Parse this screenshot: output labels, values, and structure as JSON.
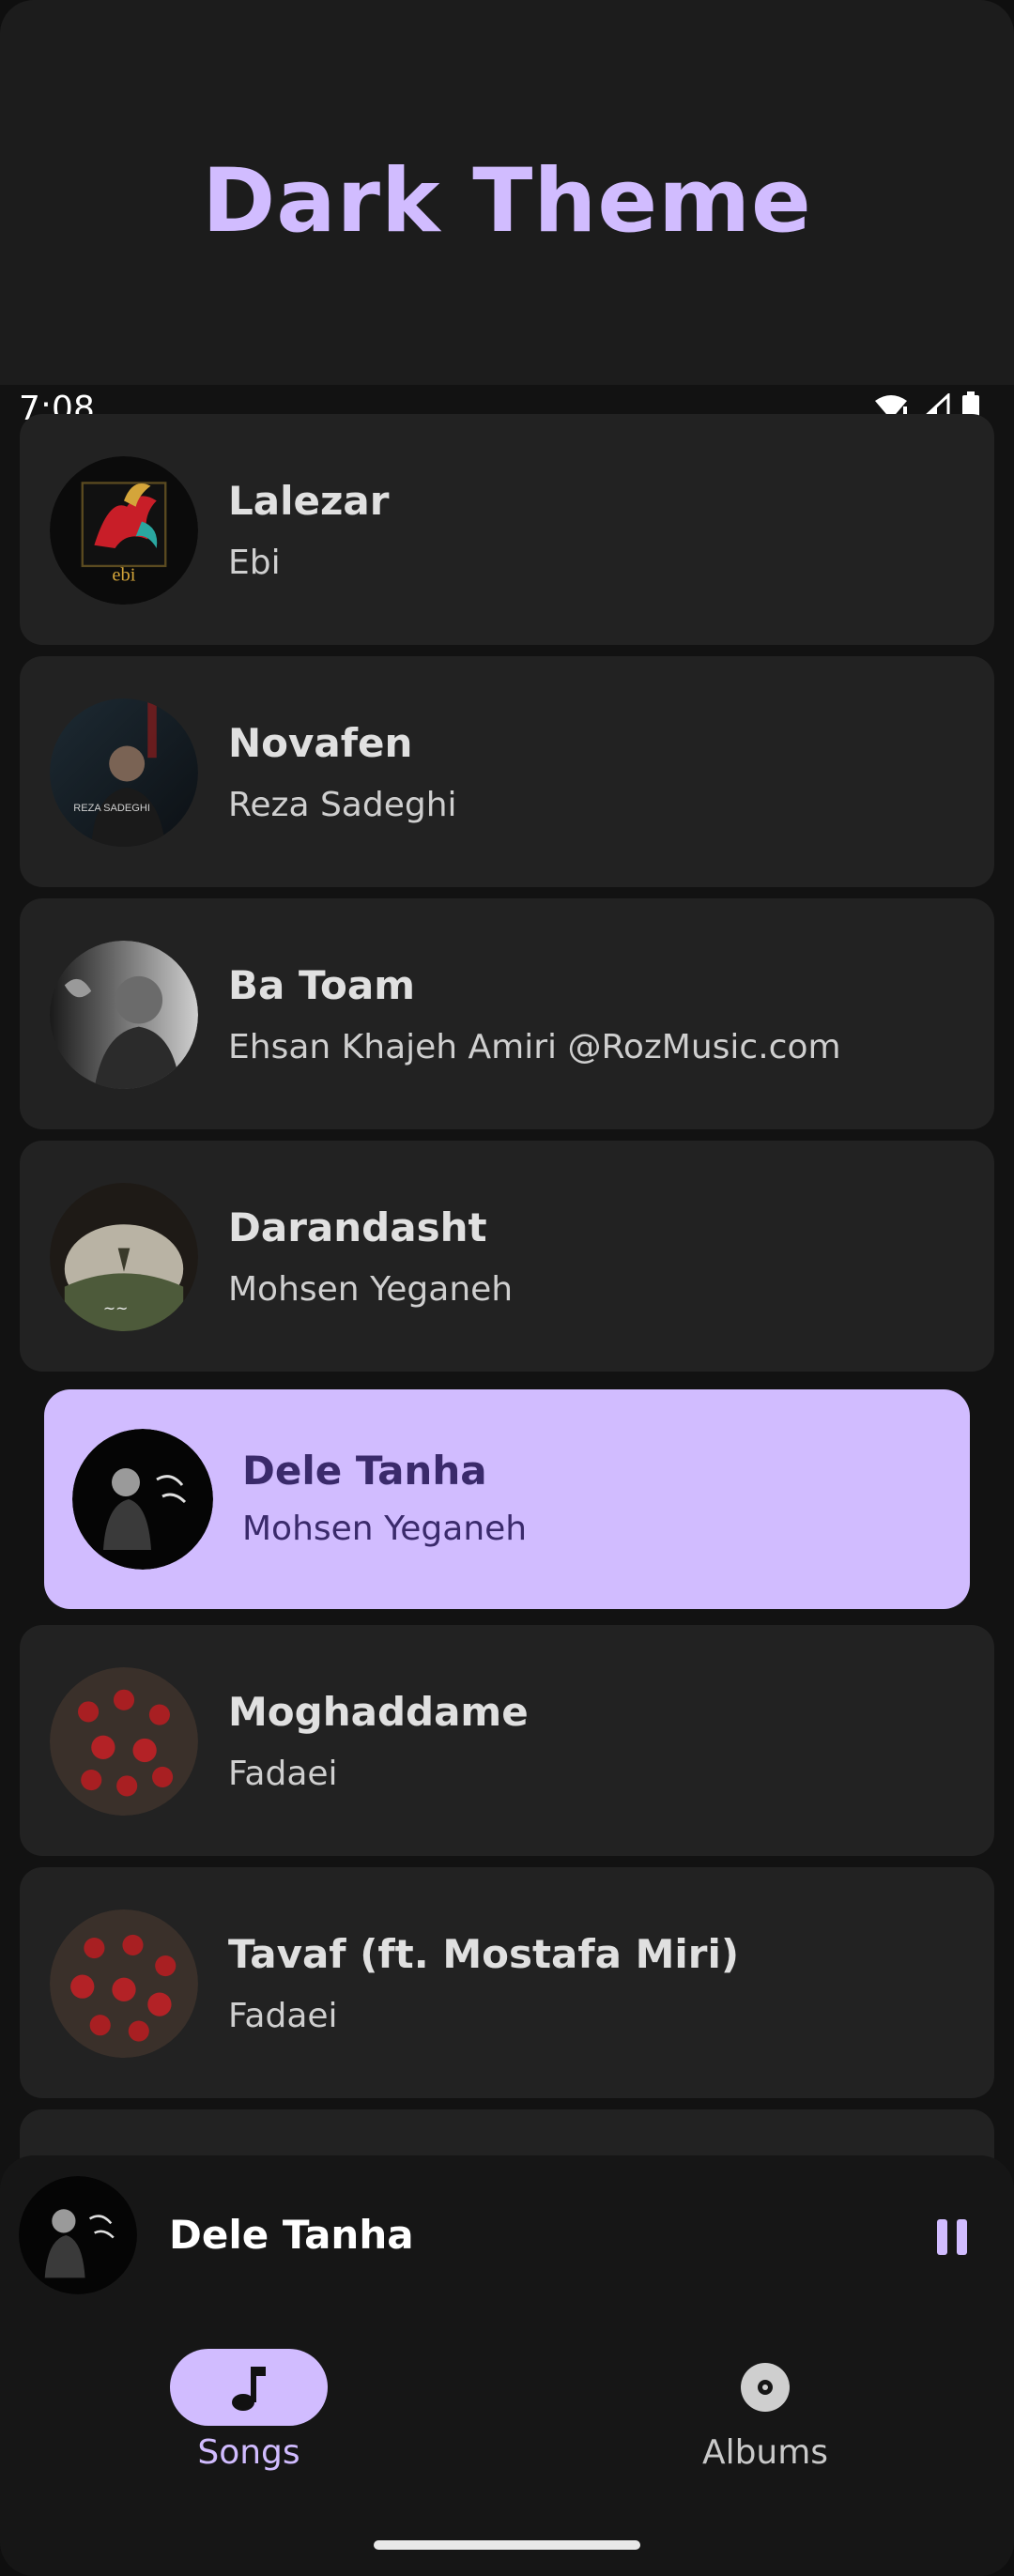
{
  "header": {
    "title": "Dark Theme"
  },
  "status_bar": {
    "time": "7:08",
    "icons": [
      "wifi-icon",
      "cellular-signal-icon",
      "battery-icon"
    ]
  },
  "songs": [
    {
      "title": "Lalezar",
      "artist": "Ebi",
      "active": false
    },
    {
      "title": "Novafen",
      "artist": "Reza Sadeghi",
      "active": false
    },
    {
      "title": "Ba Toam",
      "artist": "Ehsan Khajeh Amiri @RozMusic.com",
      "active": false
    },
    {
      "title": "Darandasht",
      "artist": "Mohsen Yeganeh",
      "active": false
    },
    {
      "title": "Dele Tanha",
      "artist": "Mohsen Yeganeh",
      "active": true
    },
    {
      "title": "Moghaddame",
      "artist": "Fadaei",
      "active": false
    },
    {
      "title": "Tavaf (ft. Mostafa Miri)",
      "artist": "Fadaei",
      "active": false
    }
  ],
  "mini_player": {
    "title": "Dele Tanha",
    "control_icon": "pause-icon"
  },
  "bottom_nav": {
    "items": [
      {
        "label": "Songs",
        "icon": "music-note-icon",
        "selected": true
      },
      {
        "label": "Albums",
        "icon": "album-disc-icon",
        "selected": false
      }
    ]
  },
  "colors": {
    "accent": "#d1bcff",
    "background": "#121212",
    "card": "#222222",
    "active_text": "#3a2a6b"
  }
}
